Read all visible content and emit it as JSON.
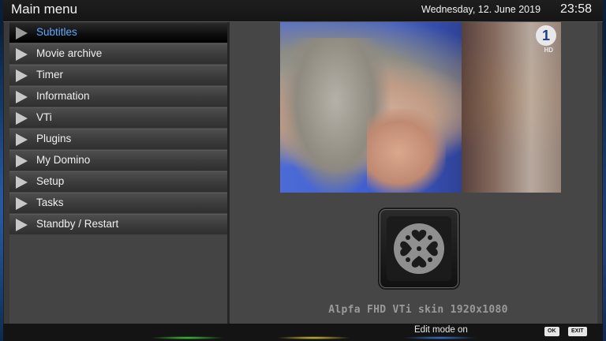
{
  "header": {
    "title": "Main menu",
    "date": "Wednesday, 12. June 2019",
    "time": "23:58"
  },
  "menu": {
    "items": [
      {
        "label": "Subtitles",
        "selected": true
      },
      {
        "label": "Movie archive",
        "selected": false
      },
      {
        "label": "Timer",
        "selected": false
      },
      {
        "label": "Information",
        "selected": false
      },
      {
        "label": "VTi",
        "selected": false
      },
      {
        "label": "Plugins",
        "selected": false
      },
      {
        "label": "My Domino",
        "selected": false
      },
      {
        "label": "Setup",
        "selected": false
      },
      {
        "label": "Tasks",
        "selected": false
      },
      {
        "label": "Standby / Restart",
        "selected": false
      }
    ]
  },
  "preview": {
    "channel_logo": "1",
    "hd_badge": "HD"
  },
  "plugin": {
    "icon": "domino-heart-icon"
  },
  "skin_label": "Alpfa FHD VTi skin 1920x1080",
  "footer": {
    "status": "Edit mode on",
    "ok_button": "OK",
    "exit_button": "EXIT"
  },
  "colors": {
    "selected_text": "#5fa8ff",
    "menu_text": "#f0f0f0",
    "panel": "#464646"
  }
}
